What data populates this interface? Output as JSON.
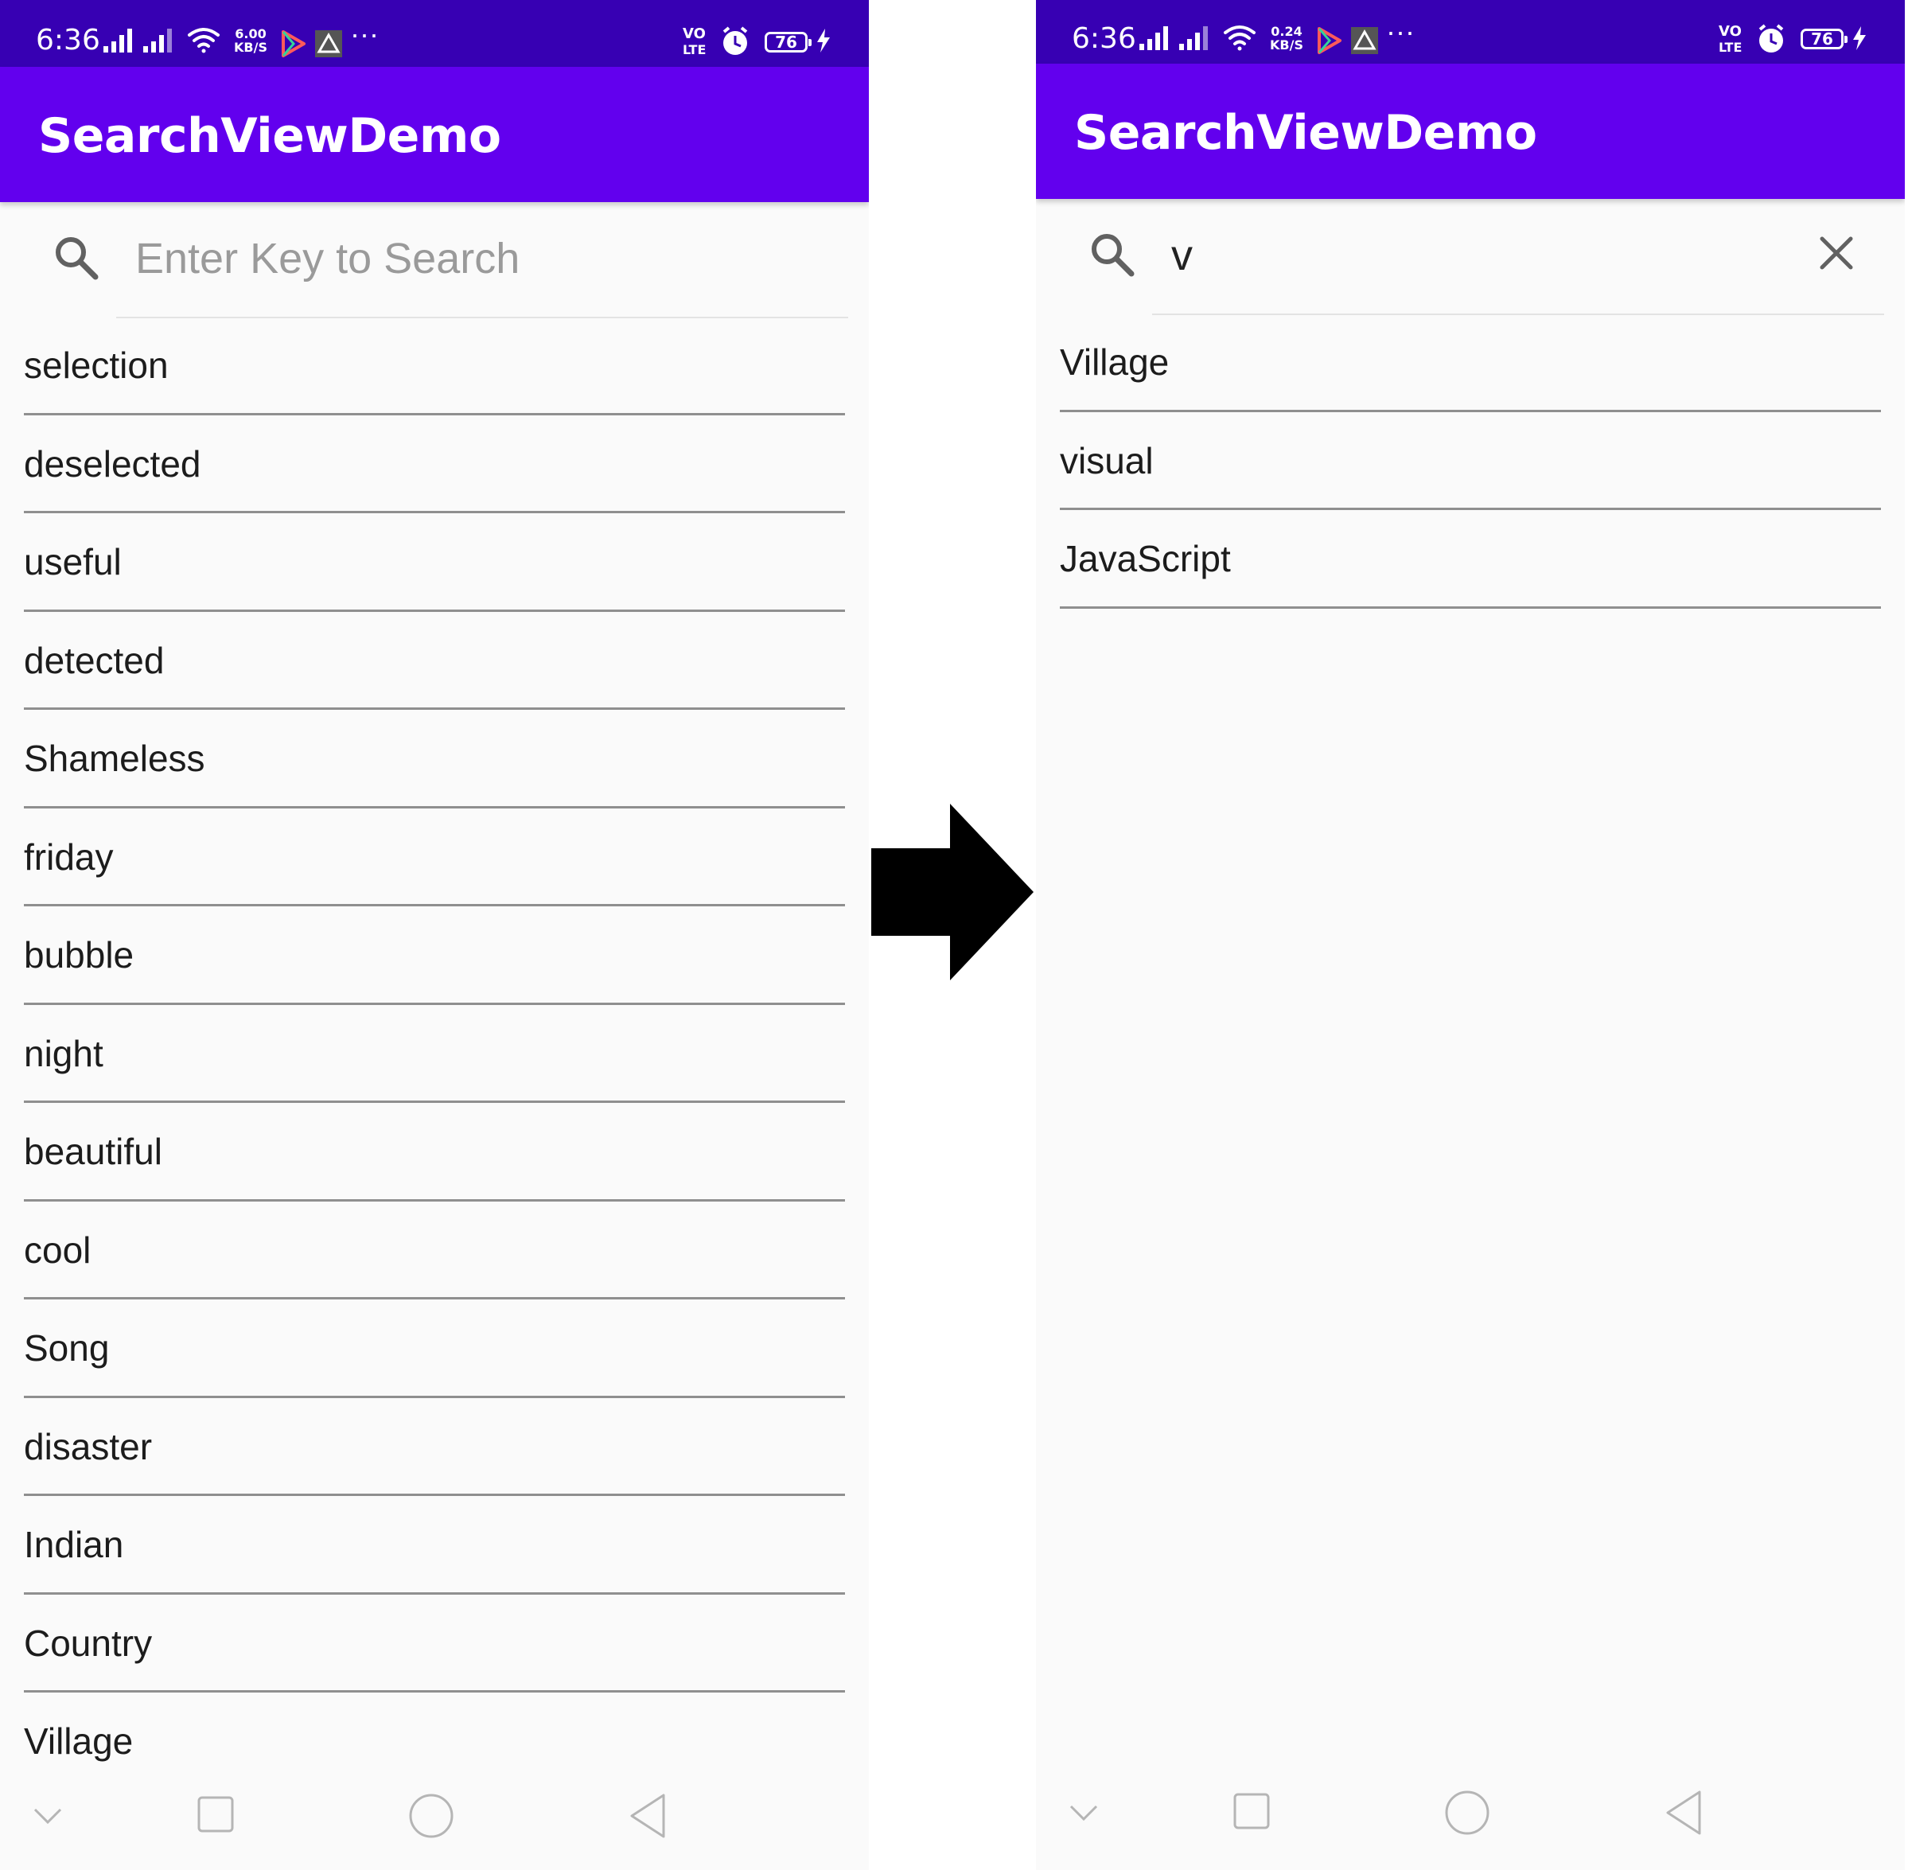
{
  "colors": {
    "statusbar": "#3700b3",
    "appbar": "#6200ee",
    "background": "#fafafa",
    "divider": "#8f8f8f"
  },
  "left": {
    "status": {
      "time": "6:36",
      "net_speed_value": "6.00",
      "net_speed_unit": "KB/S",
      "volte_top": "VO",
      "volte_bottom": "LTE",
      "more": "···",
      "battery": "76"
    },
    "app_title": "SearchViewDemo",
    "search": {
      "value": "",
      "placeholder": "Enter Key to Search"
    },
    "items": [
      "selection",
      "deselected",
      "useful",
      "detected",
      "Shameless",
      "friday",
      "bubble",
      "night",
      "beautiful",
      "cool",
      "Song",
      "disaster",
      "Indian",
      "Country",
      "Village"
    ]
  },
  "right": {
    "status": {
      "time": "6:36",
      "net_speed_value": "0.24",
      "net_speed_unit": "KB/S",
      "volte_top": "VO",
      "volte_bottom": "LTE",
      "more": "···",
      "battery": "76"
    },
    "app_title": "SearchViewDemo",
    "search": {
      "value": "v",
      "placeholder": "Enter Key to Search"
    },
    "items": [
      "Village",
      "visual",
      "JavaScript"
    ]
  },
  "icons": {
    "search": "search-icon",
    "clear": "close-icon",
    "nav": [
      "chevron-down-icon",
      "recents-icon",
      "home-icon",
      "back-icon"
    ]
  }
}
